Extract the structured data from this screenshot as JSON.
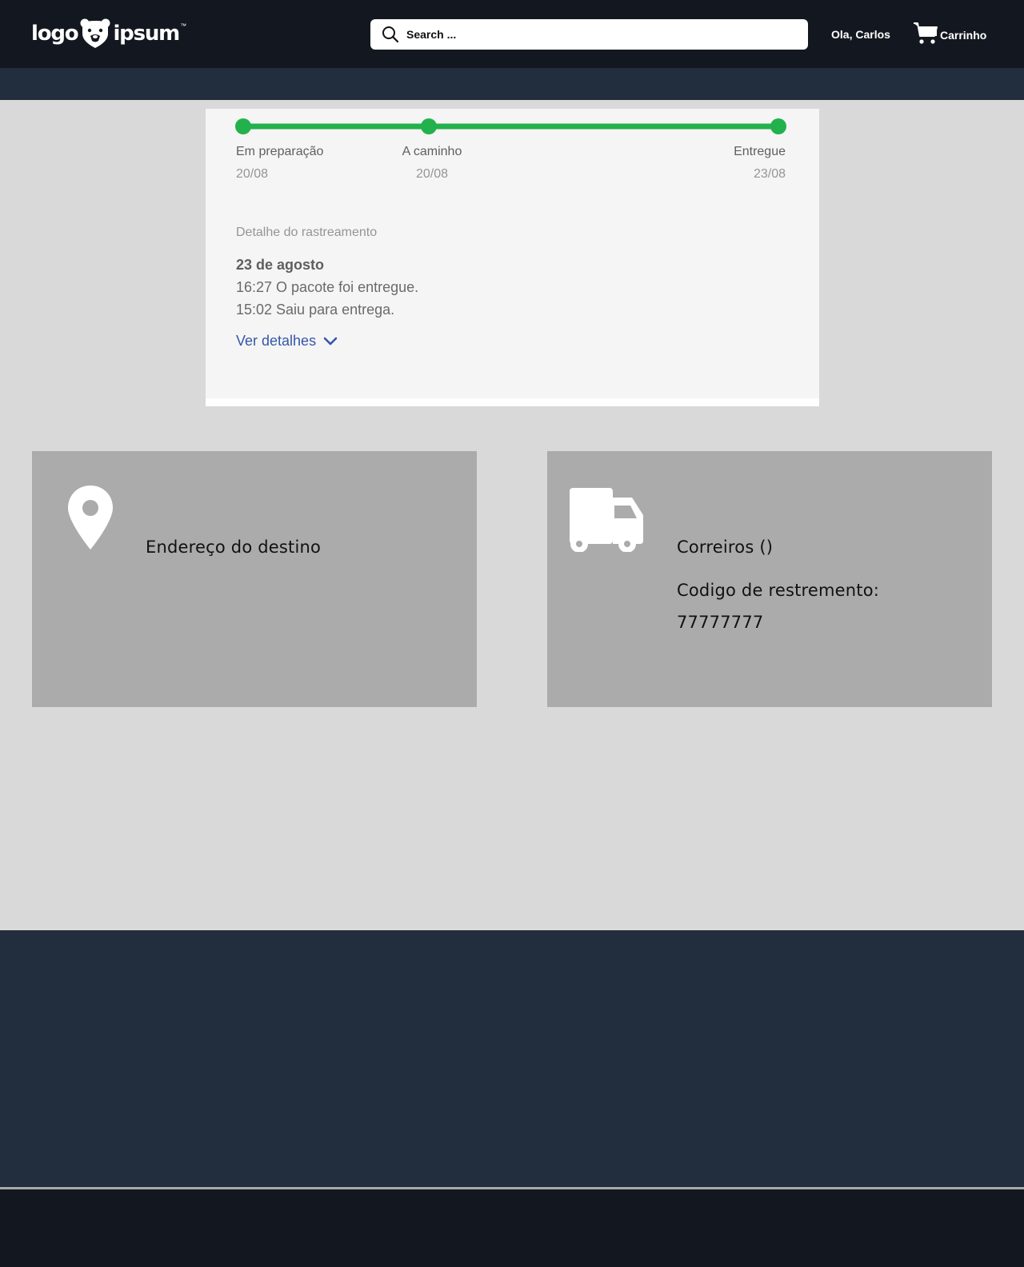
{
  "header": {
    "logo": {
      "left_word": "logo",
      "right_word": "ipsum",
      "mark": "bear-icon"
    },
    "search": {
      "placeholder": "Search ...",
      "icon": "search-icon"
    },
    "greeting": "Ola, Carlos",
    "cart": {
      "label": "Carrinho",
      "icon": "cart-icon"
    }
  },
  "tracking": {
    "progress_color": "#22b14c",
    "progress_fraction": 1.0,
    "steps": [
      {
        "name": "Em preparação",
        "date": "20/08"
      },
      {
        "name": "A caminho",
        "date": "20/08"
      },
      {
        "name": "Entregue",
        "date": "23/08"
      }
    ],
    "detail_title": "Detalhe do rastreamento",
    "detail_date": "23 de agosto",
    "events": [
      "16:27 O pacote foi entregue.",
      "15:02 Saiu para entrega."
    ],
    "more_link": "Ver detalhes",
    "more_icon": "chevron-down-icon"
  },
  "destination": {
    "icon": "map-pin-icon",
    "label": "Endereço do destino"
  },
  "shipping": {
    "icon": "truck-icon",
    "carrier": "Correiros ()",
    "code_label": "Codigo de restremento:",
    "code_value": "77777777"
  },
  "colors": {
    "topbar": "#131820",
    "subbar": "#222d3d",
    "page_bg": "#d9d9d9",
    "card_bg": "#ababab",
    "link": "#3656a8"
  }
}
